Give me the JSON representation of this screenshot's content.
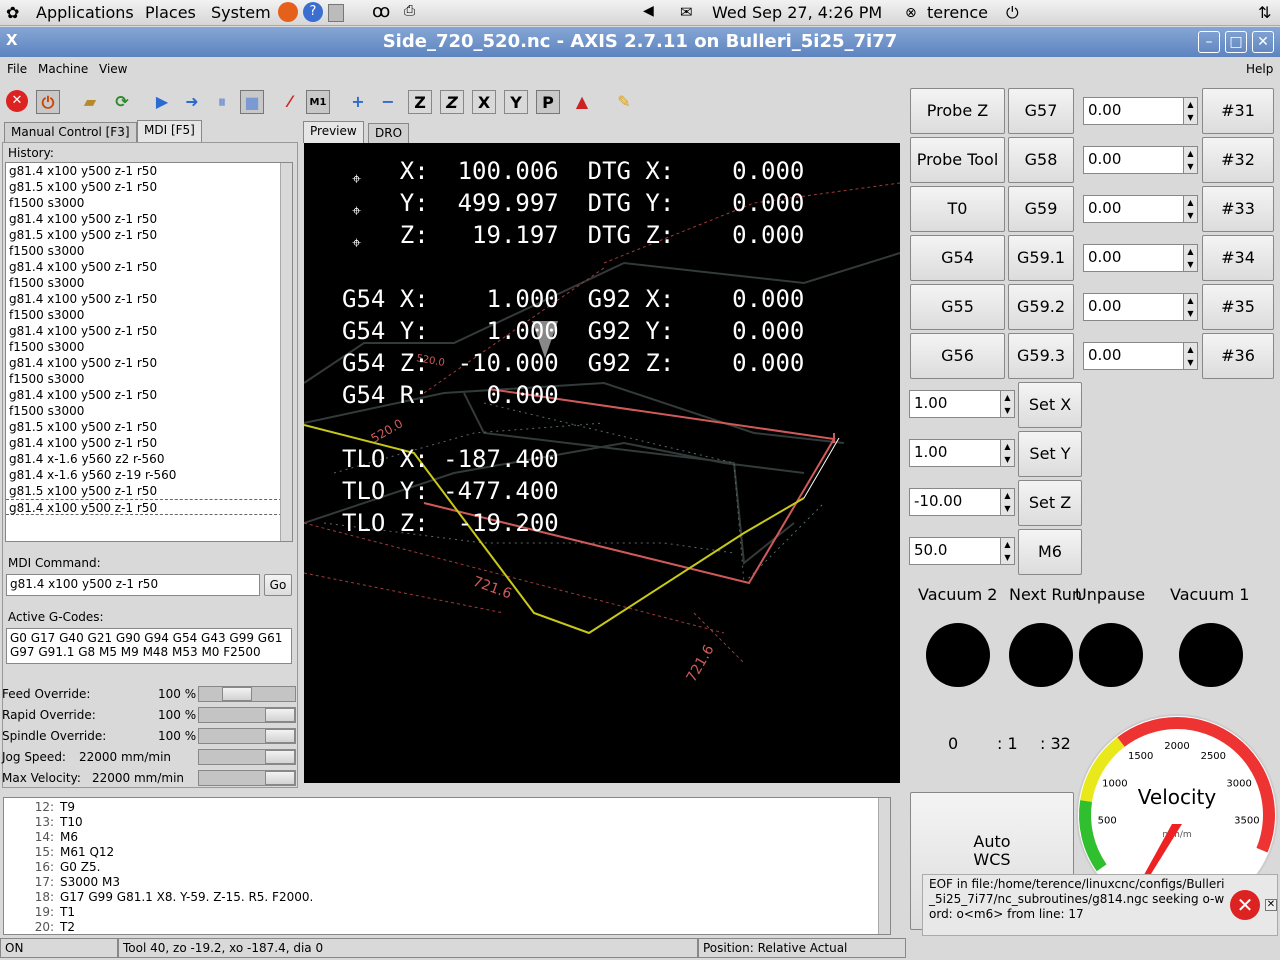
{
  "panel": {
    "applications": "Applications",
    "places": "Places",
    "system": "System",
    "datetime": "Wed Sep 27,  4:26 PM",
    "user": "terence"
  },
  "window": {
    "title": "Side_720_520.nc - AXIS 2.7.11 on Bulleri_5i25_7i77"
  },
  "menu": {
    "file": "File",
    "machine": "Machine",
    "view": "View",
    "help": "Help"
  },
  "tabs": {
    "manual": "Manual Control [F3]",
    "mdi": "MDI [F5]",
    "preview": "Preview",
    "dro": "DRO"
  },
  "mdi": {
    "history_label": "History:",
    "history": [
      "g81.4 x100 y500 z-1 r50",
      "g81.5 x100 y500 z-1 r50",
      "f1500 s3000",
      "g81.4 x100 y500 z-1 r50",
      "g81.5 x100 y500 z-1 r50",
      "f1500 s3000",
      "g81.4 x100 y500 z-1 r50",
      "f1500 s3000",
      "g81.4 x100 y500 z-1 r50",
      "f1500 s3000",
      "g81.4 x100 y500 z-1 r50",
      "f1500 s3000",
      "g81.4 x100 y500 z-1 r50",
      "f1500 s3000",
      "g81.4 x100 y500 z-1 r50",
      "f1500 s3000",
      "g81.5 x100 y500 z-1 r50",
      "g81.4 x100 y500 z-1 r50",
      "g81.4 x-1.6 y560 z2 r-560",
      "g81.4 x-1.6 y560 z-19 r-560",
      "g81.5 x100 y500 z-1 r50",
      "g81.4 x100 y500 z-1 r50"
    ],
    "command_label": "MDI Command:",
    "command_value": "g81.4 x100 y500 z-1 r50",
    "go": "Go",
    "active_label": "Active G-Codes:",
    "active_line1": "G0 G17 G40 G21 G90 G94 G54 G43 G99 G61",
    "active_line2": "G97 G91.1 G8 M5 M9 M48 M53 M0 F2500"
  },
  "overrides": [
    {
      "label": "Feed Override:",
      "value": "100 %",
      "level": 0.35
    },
    {
      "label": "Rapid Override:",
      "value": "100 %",
      "level": 1.0
    },
    {
      "label": "Spindle Override:",
      "value": "100 %",
      "level": 1.0
    },
    {
      "label": "Jog Speed:",
      "value": "22000 mm/min",
      "level": 1.0
    },
    {
      "label": "Max Velocity:",
      "value": "22000 mm/min",
      "level": 1.0
    }
  ],
  "dro": {
    "lines": [
      "    X:  100.006  DTG X:    0.000",
      "    Y:  499.997  DTG Y:    0.000",
      "    Z:   19.197  DTG Z:    0.000",
      "",
      "G54 X:    1.000  G92 X:    0.000",
      "G54 Y:    1.000  G92 Y:    0.000",
      "G54 Z:  -10.000  G92 Z:    0.000",
      "G54 R:    0.000",
      "",
      "TLO X: -187.400",
      "TLO Y: -477.400",
      "TLO Z:  -19.200"
    ],
    "dim1": "721.6",
    "dim2": "721.6",
    "dim3": "520.0",
    "dim4": "520.0"
  },
  "gcode": [
    {
      "n": "12:",
      "t": "T9"
    },
    {
      "n": "13:",
      "t": "T10"
    },
    {
      "n": "14:",
      "t": "M6"
    },
    {
      "n": "15:",
      "t": "M61 Q12"
    },
    {
      "n": "16:",
      "t": "G0 Z5."
    },
    {
      "n": "17:",
      "t": "S3000 M3"
    },
    {
      "n": "18:",
      "t": "G17 G99 G81.1 X8. Y-59. Z-15. R5. F2000."
    },
    {
      "n": "19:",
      "t": "T1"
    },
    {
      "n": "20:",
      "t": "T2"
    }
  ],
  "status": {
    "state": "ON",
    "tool": "Tool 40, zo -19.2, xo -187.4, dia 0",
    "position": "Position: Relative Actual"
  },
  "right": {
    "probe_z": "Probe Z",
    "probe_tool": "Probe Tool",
    "t0": "T0",
    "g54": "G54",
    "g55": "G55",
    "g56": "G56",
    "wcs": [
      "G57",
      "G58",
      "G59",
      "G59.1",
      "G59.2",
      "G59.3"
    ],
    "wcs_vals": [
      "0.00",
      "0.00",
      "0.00",
      "0.00",
      "0.00",
      "0.00"
    ],
    "params": [
      "#31",
      "#32",
      "#33",
      "#34",
      "#35",
      "#36"
    ],
    "set_vals": [
      "1.00",
      "1.00",
      "-10.00",
      "50.0"
    ],
    "set_x": "Set X",
    "set_y": "Set Y",
    "set_z": "Set Z",
    "m6": "M6",
    "vac2": "Vacuum 2",
    "next_run": "Next Run",
    "unpause": "Unpause",
    "vac1": "Vacuum 1",
    "timer_h": "0",
    "timer_m": ": 1",
    "timer_s": ": 32",
    "auto_wcs_1": "Auto",
    "auto_wcs_2": "WCS",
    "velocity": "Velocity",
    "units": "mm/m",
    "gauge_ticks": [
      "500",
      "1000",
      "1500",
      "2000",
      "2500",
      "3000",
      "3500"
    ],
    "error_msg": "EOF in file:/home/terence/linuxcnc/configs/Bulleri_5i25_7i77/nc_subroutines/g814.ngc seeking o-word: o<m6> from line: 17"
  }
}
